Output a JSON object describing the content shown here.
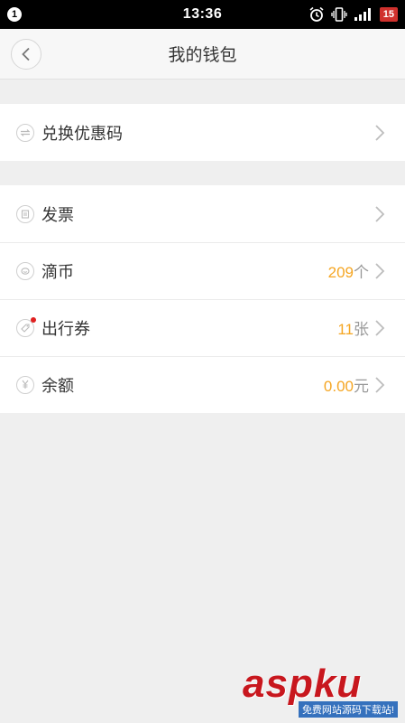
{
  "status_bar": {
    "notification_count": "1",
    "time": "13:36",
    "battery": "15"
  },
  "header": {
    "title": "我的钱包"
  },
  "group1": [
    {
      "label": "兑换优惠码",
      "icon": "exchange-icon"
    }
  ],
  "group2": [
    {
      "label": "发票",
      "icon": "receipt-icon"
    },
    {
      "label": "滴币",
      "icon": "coin-icon",
      "value": "209",
      "unit": "个"
    },
    {
      "label": "出行券",
      "icon": "ticket-icon",
      "value": "11",
      "unit": "张",
      "has_dot": true
    },
    {
      "label": "余额",
      "icon": "yuan-icon",
      "value": "0.00",
      "unit": "元"
    }
  ],
  "colors": {
    "accent_value": "#f5a623",
    "dot": "#e02020"
  },
  "watermark": {
    "brand": "aspku",
    "subtitle": "免费网站源码下载站!"
  }
}
